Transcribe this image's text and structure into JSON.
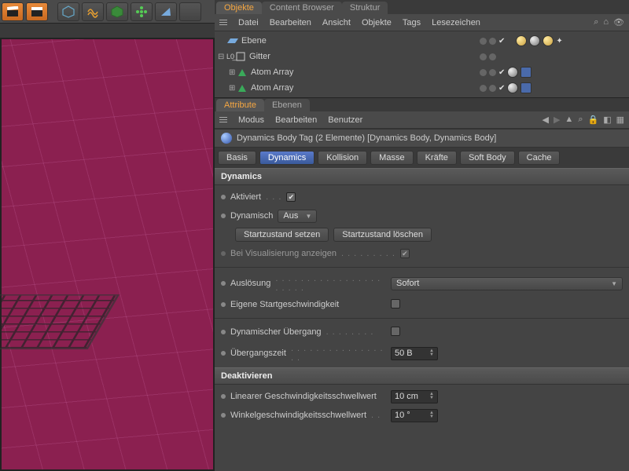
{
  "tabs_top": {
    "objekte": "Objekte",
    "content_browser": "Content Browser",
    "struktur": "Struktur"
  },
  "obj_menu": {
    "datei": "Datei",
    "bearbeiten": "Bearbeiten",
    "ansicht": "Ansicht",
    "objekte": "Objekte",
    "tags": "Tags",
    "lesezeichen": "Lesezeichen"
  },
  "tree": {
    "ebene": "Ebene",
    "gitter": "Gitter",
    "atom1": "Atom Array",
    "atom2": "Atom Array"
  },
  "attr_tabs": {
    "attribute": "Attribute",
    "ebenen": "Ebenen"
  },
  "attr_menu": {
    "modus": "Modus",
    "bearbeiten": "Bearbeiten",
    "benutzer": "Benutzer"
  },
  "attr_title": "Dynamics Body Tag (2 Elemente) [Dynamics Body, Dynamics Body]",
  "prop_tabs": {
    "basis": "Basis",
    "dynamics": "Dynamics",
    "kollision": "Kollision",
    "masse": "Masse",
    "kraefte": "Kräfte",
    "softbody": "Soft Body",
    "cache": "Cache"
  },
  "sections": {
    "dynamics": "Dynamics",
    "deaktivieren": "Deaktivieren"
  },
  "props": {
    "aktiviert": "Aktiviert",
    "dynamisch": "Dynamisch",
    "dynamisch_val": "Aus",
    "startzustand_setzen": "Startzustand setzen",
    "startzustand_loeschen": "Startzustand löschen",
    "bei_vis": "Bei Visualisierung anzeigen",
    "ausloesung": "Auslösung",
    "ausloesung_val": "Sofort",
    "eigene_start": "Eigene Startgeschwindigkeit",
    "dyn_uebergang": "Dynamischer Übergang",
    "uebergangszeit": "Übergangszeit",
    "uebergangszeit_val": "50 B",
    "lin_schwell": "Linearer Geschwindigkeitsschwellwert",
    "lin_schwell_val": "10 cm",
    "winkel_schwell": "Winkelgeschwindigkeitsschwellwert",
    "winkel_schwell_val": "10 °"
  }
}
